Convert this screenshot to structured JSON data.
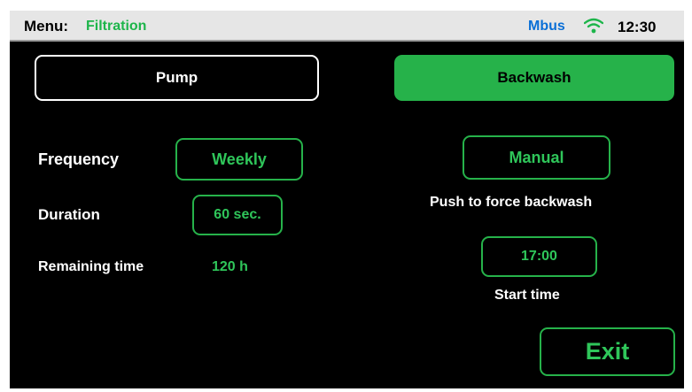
{
  "header": {
    "menu_label": "Menu:",
    "menu_value": "Filtration",
    "bus_label": "Mbus",
    "wifi_icon": "wifi-icon",
    "time": "12:30"
  },
  "tabs": {
    "pump": "Pump",
    "backwash": "Backwash"
  },
  "pump": {
    "frequency_label": "Frequency",
    "frequency_value": "Weekly",
    "duration_label": "Duration",
    "duration_value": "60 sec.",
    "remaining_label": "Remaining time",
    "remaining_value": "120 h"
  },
  "backwash": {
    "manual_button": "Manual",
    "manual_hint": "Push to force backwash",
    "start_time_value": "17:00",
    "start_time_label": "Start time"
  },
  "footer": {
    "exit_label": "Exit"
  },
  "colors": {
    "accent_green": "#26b24a",
    "bus_blue": "#0a6fd6",
    "background": "#000000"
  }
}
